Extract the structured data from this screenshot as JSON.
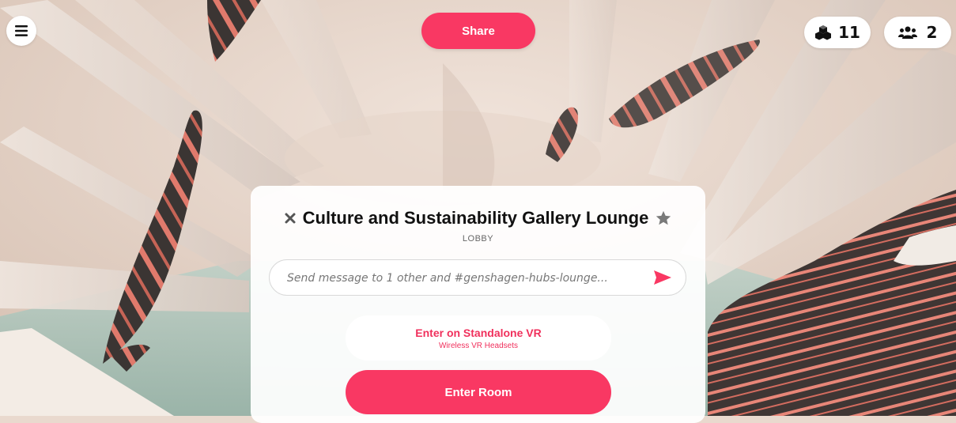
{
  "topbar": {
    "menu_icon": "hamburger-menu-icon",
    "share_label": "Share",
    "objects_icon": "objects-cubes-icon",
    "objects_count": "11",
    "people_icon": "people-group-icon",
    "people_count": "2"
  },
  "room": {
    "title": "Culture and Sustainability Gallery Lounge",
    "subtitle": "LOBBY",
    "close_icon": "close-icon",
    "favorite_icon": "star-icon"
  },
  "chat": {
    "placeholder": "Send message to 1 other and #genshagen-hubs-lounge...",
    "value": "",
    "send_icon": "send-arrow-icon"
  },
  "actions": {
    "standalone_label": "Enter on Standalone VR",
    "standalone_sublabel": "Wireless VR Headsets",
    "enter_room_label": "Enter Room"
  },
  "colors": {
    "accent": "#f93863",
    "accent_text": "#f0305c",
    "panel": "#ffffff",
    "scene_background": "#e9d9ce"
  }
}
